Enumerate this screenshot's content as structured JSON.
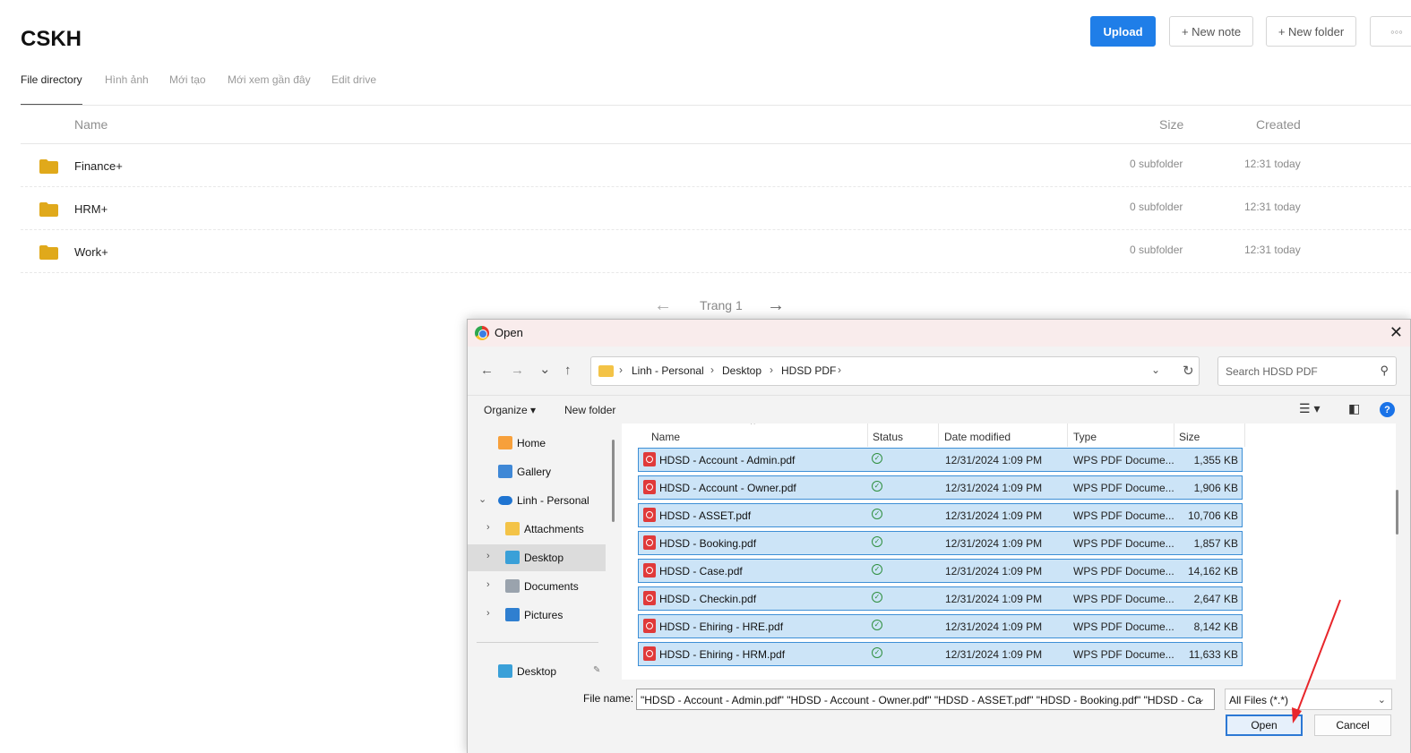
{
  "app": {
    "title": "CSKH",
    "actions": [
      {
        "label": "Upload",
        "name": "upload-button",
        "primary": true
      },
      {
        "label": "+ New note",
        "name": "new-note-button"
      },
      {
        "label": "+ New folder",
        "name": "new-folder-button"
      },
      {
        "label": "◦◦◦",
        "name": "more-button"
      }
    ],
    "tabs": [
      "File directory",
      "Hình ảnh",
      "Mới tạo",
      "Mới xem gần đây",
      "Edit drive"
    ],
    "columns": {
      "name": "Name",
      "size": "Size",
      "created": "Created"
    },
    "rows": [
      {
        "name": "Finance+",
        "size": "0 subfolder",
        "created": "12:31 today"
      },
      {
        "name": "HRM+",
        "size": "0 subfolder",
        "created": "12:31 today"
      },
      {
        "name": "Work+",
        "size": "0 subfolder",
        "created": "12:31 today"
      }
    ],
    "pager": {
      "label": "Trang 1",
      "prev": "←",
      "next": "→"
    }
  },
  "dialog": {
    "title": "Open",
    "close": "✕",
    "nav": {
      "back": "←",
      "forward": "→",
      "recent": "⌄",
      "up": "↑"
    },
    "breadcrumb": [
      "Linh - Personal",
      "Desktop",
      "HDSD PDF"
    ],
    "search_placeholder": "Search HDSD PDF",
    "commands": {
      "organize": "Organize ▾",
      "new_folder": "New folder",
      "help": "?"
    },
    "sidebar": [
      {
        "label": "Home",
        "icon": "home-icon"
      },
      {
        "label": "Gallery",
        "icon": "gallery-icon"
      },
      {
        "label": "Linh - Personal",
        "icon": "cloud-icon"
      },
      {
        "label": "Attachments",
        "icon": "folder-icon"
      },
      {
        "label": "Desktop",
        "icon": "desktop-icon"
      },
      {
        "label": "Documents",
        "icon": "documents-icon"
      },
      {
        "label": "Pictures",
        "icon": "pictures-icon"
      },
      {
        "label": "Desktop",
        "icon": "desktop-icon"
      }
    ],
    "columns": {
      "name": "Name",
      "status": "Status",
      "date": "Date modified",
      "type": "Type",
      "size": "Size"
    },
    "files": [
      {
        "name": "HDSD - Account - Admin.pdf",
        "date": "12/31/2024 1:09 PM",
        "type": "WPS PDF Docume...",
        "size": "1,355 KB"
      },
      {
        "name": "HDSD - Account - Owner.pdf",
        "date": "12/31/2024 1:09 PM",
        "type": "WPS PDF Docume...",
        "size": "1,906 KB"
      },
      {
        "name": "HDSD - ASSET.pdf",
        "date": "12/31/2024 1:09 PM",
        "type": "WPS PDF Docume...",
        "size": "10,706 KB"
      },
      {
        "name": "HDSD - Booking.pdf",
        "date": "12/31/2024 1:09 PM",
        "type": "WPS PDF Docume...",
        "size": "1,857 KB"
      },
      {
        "name": "HDSD - Case.pdf",
        "date": "12/31/2024 1:09 PM",
        "type": "WPS PDF Docume...",
        "size": "14,162 KB"
      },
      {
        "name": "HDSD - Checkin.pdf",
        "date": "12/31/2024 1:09 PM",
        "type": "WPS PDF Docume...",
        "size": "2,647 KB"
      },
      {
        "name": "HDSD - Ehiring - HRE.pdf",
        "date": "12/31/2024 1:09 PM",
        "type": "WPS PDF Docume...",
        "size": "8,142 KB"
      },
      {
        "name": "HDSD - Ehiring - HRM.pdf",
        "date": "12/31/2024 1:09 PM",
        "type": "WPS PDF Docume...",
        "size": "11,633 KB"
      }
    ],
    "file_name_label": "File name:",
    "file_name_value": "\"HDSD - Account - Admin.pdf\" \"HDSD - Account - Owner.pdf\" \"HDSD - ASSET.pdf\" \"HDSD - Booking.pdf\" \"HDSD - Ca",
    "filter": "All Files (*.*)",
    "open_label": "Open",
    "cancel_label": "Cancel"
  },
  "colors": {
    "accent": "#1f7ee8",
    "folder": "#e0a91b",
    "selection": "#cce4f7",
    "annotation": "#e8262b"
  }
}
